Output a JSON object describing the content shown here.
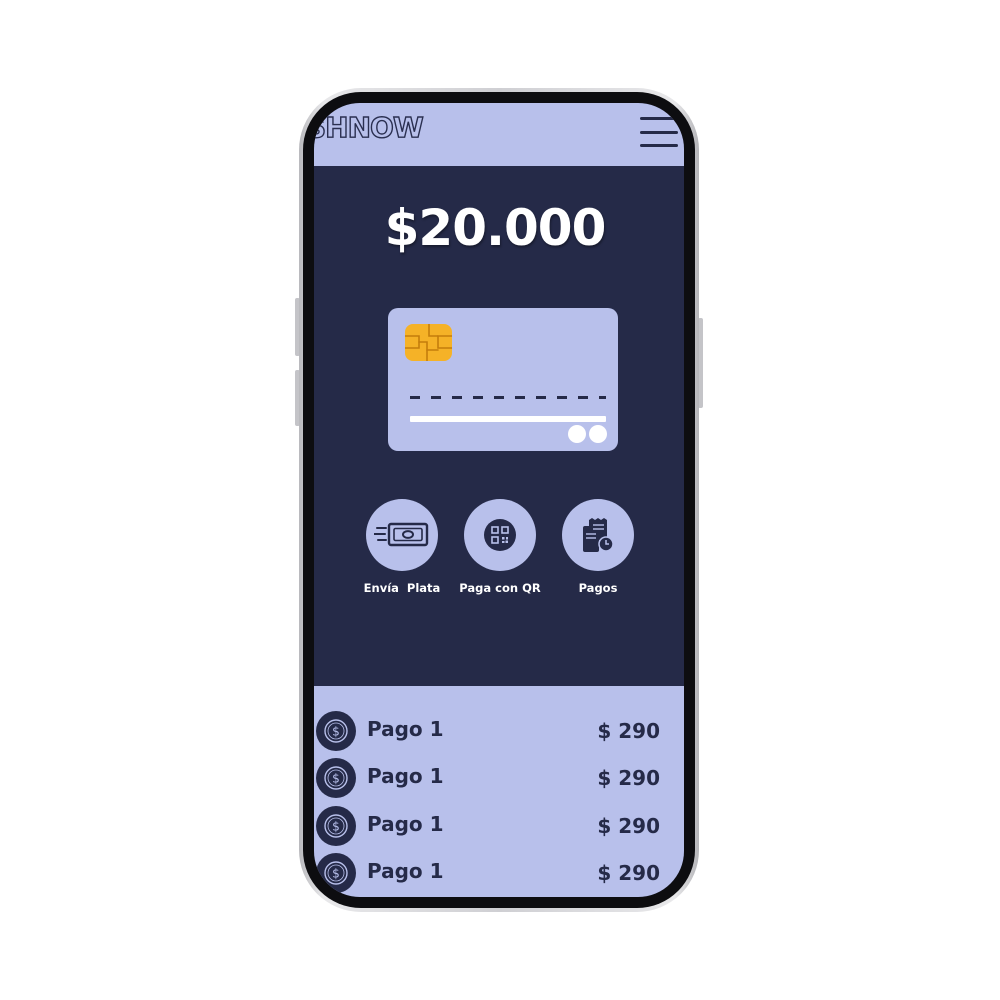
{
  "app": {
    "logo_text": "SHNOW"
  },
  "balance": {
    "amount": "$20.000"
  },
  "actions": [
    {
      "label": "Envía  Plata",
      "icon": "money-send-icon"
    },
    {
      "label": "Paga con QR",
      "icon": "qr-code-icon"
    },
    {
      "label": "Pagos",
      "icon": "receipt-icon"
    }
  ],
  "payments": [
    {
      "title": "Pago 1",
      "amount": "$ 290",
      "icon": "dollar-coin-icon"
    },
    {
      "title": "Pago 1",
      "amount": "$ 290",
      "icon": "dollar-coin-icon"
    },
    {
      "title": "Pago 1",
      "amount": "$ 290",
      "icon": "dollar-coin-icon"
    },
    {
      "title": "Pago 1",
      "amount": "$ 290",
      "icon": "dollar-coin-icon"
    }
  ],
  "colors": {
    "primary_dark": "#252a48",
    "accent_light": "#b8c0eb",
    "chip": "#f5b227"
  }
}
